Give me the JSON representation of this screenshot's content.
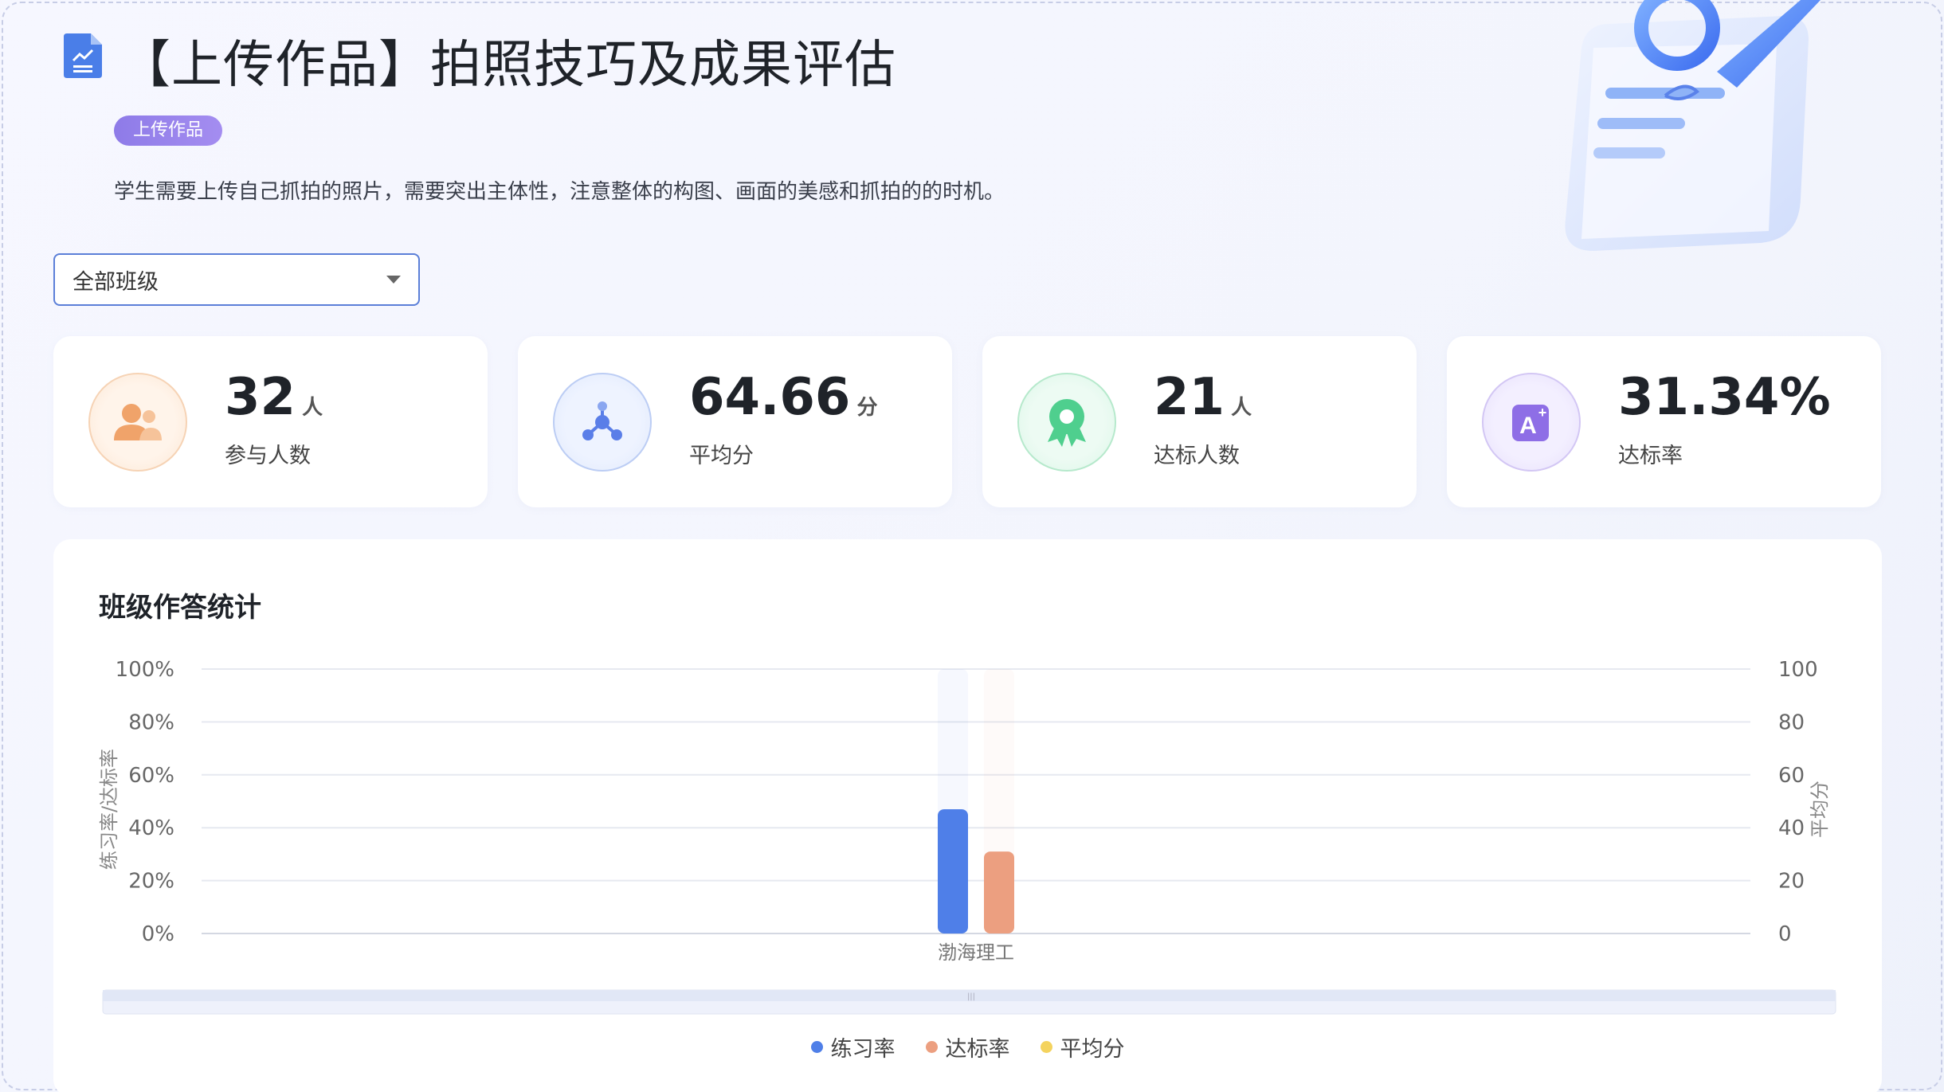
{
  "header": {
    "title": "【上传作品】拍照技巧及成果评估",
    "tag": "上传作品",
    "description": "学生需要上传自己抓拍的照片，需要突出主体性，注意整体的构图、画面的美感和抓拍的的时机。"
  },
  "filter": {
    "selected": "全部班级"
  },
  "stats": [
    {
      "value": "32",
      "unit": "人",
      "label": "参与人数",
      "icon": "people-icon",
      "color": "#f0a36a"
    },
    {
      "value": "64.66",
      "unit": "分",
      "label": "平均分",
      "icon": "molecule-icon",
      "color": "#5a7ee8"
    },
    {
      "value": "21",
      "unit": "人",
      "label": "达标人数",
      "icon": "award-icon",
      "color": "#4fcf8e"
    },
    {
      "value": "31.34%",
      "unit": "",
      "label": "达标率",
      "icon": "grade-a-icon",
      "color": "#8e6ee6"
    }
  ],
  "chart": {
    "title": "班级作答统计"
  },
  "chart_data": {
    "type": "bar",
    "categories": [
      "渤海理工"
    ],
    "series": [
      {
        "name": "练习率",
        "values": [
          47
        ],
        "color": "#4f7fe8",
        "axis": "left"
      },
      {
        "name": "达标率",
        "values": [
          31
        ],
        "color": "#ec9f80",
        "axis": "left"
      },
      {
        "name": "平均分",
        "values": [
          null
        ],
        "color": "#f4d35e",
        "axis": "right"
      }
    ],
    "ylabel": "练习率/达标率",
    "ylabel_right": "平均分",
    "y_ticks_left": [
      "0%",
      "20%",
      "40%",
      "60%",
      "80%",
      "100%"
    ],
    "y_ticks_right": [
      "0",
      "20",
      "40",
      "60",
      "80",
      "100"
    ],
    "ylim": [
      0,
      100
    ],
    "ylim_right": [
      0,
      100
    ],
    "grid": true,
    "legend": "bottom-center"
  }
}
